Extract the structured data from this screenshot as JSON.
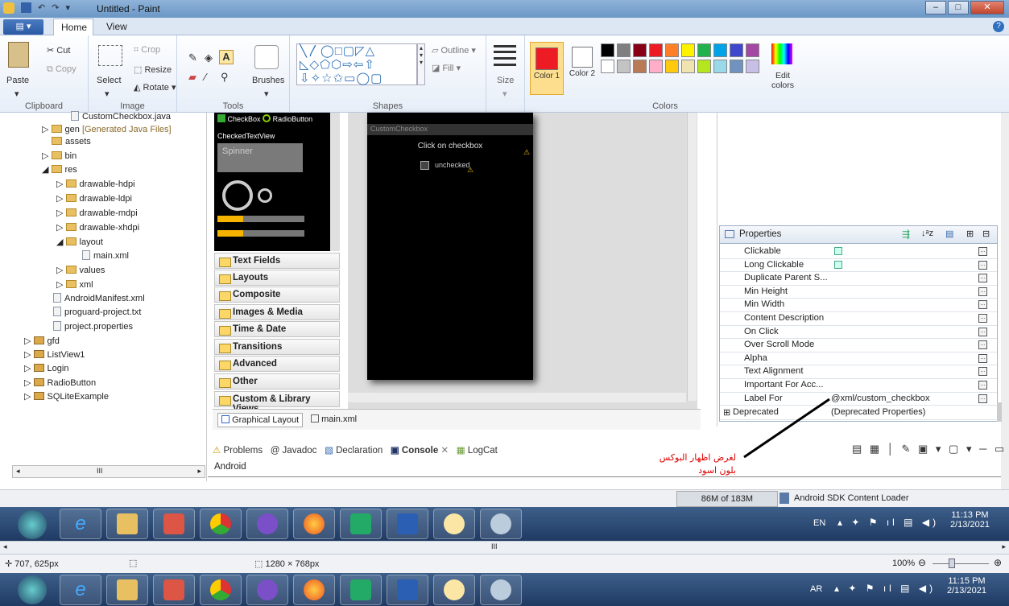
{
  "window": {
    "title": "Untitled - Paint"
  },
  "menu": {
    "tabs": [
      "Home",
      "View"
    ]
  },
  "ribbon": {
    "clipboard": {
      "paste": "Paste",
      "cut": "Cut",
      "copy": "Copy",
      "label": "Clipboard"
    },
    "image": {
      "select": "Select",
      "crop": "Crop",
      "resize": "Resize",
      "rotate": "Rotate",
      "label": "Image"
    },
    "tools": {
      "label": "Tools",
      "brushes": "Brushes",
      "text_tool": "A"
    },
    "shapes": {
      "outline": "Outline",
      "fill": "Fill",
      "label": "Shapes"
    },
    "size": {
      "label": "Size"
    },
    "colors": {
      "color1": "Color 1",
      "color1_num": "1",
      "color2": "Color 2",
      "color2_num": "2",
      "edit": "Edit colors",
      "label": "Colors",
      "color1_value": "#ed1c24",
      "color2_value": "#ffffff",
      "palette": [
        "#000000",
        "#7f7f7f",
        "#880015",
        "#ed1c24",
        "#ff7f27",
        "#fff200",
        "#22b14c",
        "#00a2e8",
        "#3f48cc",
        "#a349a4",
        "#ffffff",
        "#c3c3c3",
        "#b97a57",
        "#ffaec9",
        "#ffc90e",
        "#efe4b0",
        "#b5e61d",
        "#99d9ea",
        "#7092be",
        "#c8bfe7"
      ]
    }
  },
  "tree": {
    "items": [
      {
        "label": "CustomCheckbox.java"
      },
      {
        "label": "gen",
        "extra": "[Generated Java Files]"
      },
      {
        "label": "assets"
      },
      {
        "label": "bin"
      },
      {
        "label": "res"
      },
      {
        "label": "drawable-hdpi"
      },
      {
        "label": "drawable-ldpi"
      },
      {
        "label": "drawable-mdpi"
      },
      {
        "label": "drawable-xhdpi"
      },
      {
        "label": "layout"
      },
      {
        "label": "main.xml"
      },
      {
        "label": "values"
      },
      {
        "label": "xml"
      },
      {
        "label": "AndroidManifest.xml"
      },
      {
        "label": "proguard-project.txt"
      },
      {
        "label": "project.properties"
      },
      {
        "label": "gfd"
      },
      {
        "label": "ListView1"
      },
      {
        "label": "Login"
      },
      {
        "label": "RadioButton"
      },
      {
        "label": "SQLiteExample"
      }
    ],
    "scroll_mark": "III"
  },
  "widget_preview": {
    "checkbox": "CheckBox",
    "radio": "RadioButton",
    "checked_text": "CheckedTextView",
    "spinner": "Spinner"
  },
  "palette_groups": [
    "Text Fields",
    "Layouts",
    "Composite",
    "Images & Media",
    "Time & Date",
    "Transitions",
    "Advanced",
    "Other",
    "Custom & Library Views"
  ],
  "phone": {
    "app_title": "CustomCheckbox",
    "heading": "Click on checkbox",
    "checkbox_label": "unchecked"
  },
  "editor_tabs": [
    "Graphical Layout",
    "main.xml"
  ],
  "properties": {
    "title": "Properties",
    "rows": [
      {
        "name": "Clickable",
        "value": ""
      },
      {
        "name": "Long Clickable",
        "value": ""
      },
      {
        "name": "Duplicate Parent S...",
        "value": ""
      },
      {
        "name": "Min Height",
        "value": ""
      },
      {
        "name": "Min Width",
        "value": ""
      },
      {
        "name": "Content Description",
        "value": ""
      },
      {
        "name": "On Click",
        "value": ""
      },
      {
        "name": "Over Scroll Mode",
        "value": ""
      },
      {
        "name": "Alpha",
        "value": ""
      },
      {
        "name": "Text Alignment",
        "value": ""
      },
      {
        "name": "Important For Acc...",
        "value": ""
      },
      {
        "name": "Label For",
        "value": "@xml/custom_checkbox"
      }
    ],
    "deprecated": "Deprecated",
    "deprecated_value": "(Deprecated Properties)",
    "more_btn": "..."
  },
  "console": {
    "tabs": [
      "Problems",
      "@ Javadoc",
      "Declaration",
      "Console",
      "LogCat"
    ],
    "content": "Android",
    "annotation_line1": "لغرض اظهار البوكس",
    "annotation_line2": "بلون اسود"
  },
  "status": {
    "memory": "86M of 183M",
    "loader": "Android SDK Content Loader"
  },
  "taskbar1": {
    "lang": "EN",
    "time": "11:13 PM",
    "date": "2/13/2021"
  },
  "paint_status": {
    "cursor": "707, 625px",
    "size": "1280 × 768px",
    "zoom": "100%",
    "scroll_mark": "III"
  },
  "taskbar2": {
    "lang": "AR",
    "time": "11:15 PM",
    "date": "2/13/2021"
  }
}
